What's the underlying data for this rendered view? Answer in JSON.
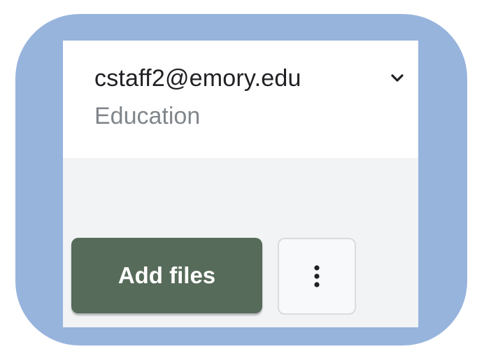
{
  "account": {
    "email": "cstaff2@emory.edu",
    "organization": "Education",
    "dropdown_icon": "chevron-down-icon"
  },
  "actions": {
    "add_files_label": "Add files",
    "more_icon": "more-vert-icon"
  },
  "colors": {
    "frame": "#97b4dd",
    "panel_background": "#f1f3f4",
    "add_button": "#566b59",
    "email_text": "#202124",
    "org_text": "#80868b"
  }
}
